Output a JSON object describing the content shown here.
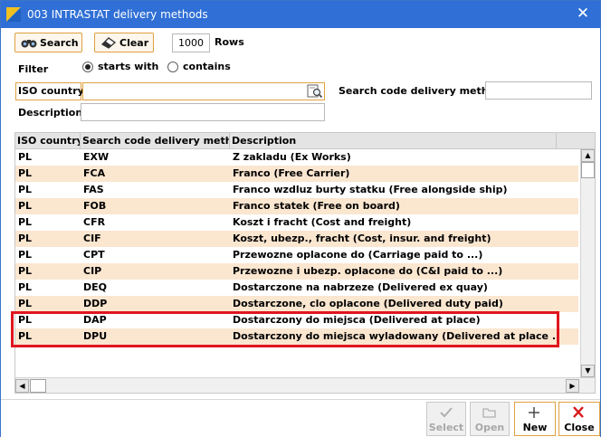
{
  "window": {
    "title": "003 INTRASTAT delivery methods",
    "close_glyph": "✕"
  },
  "toolbar": {
    "search_label": "Search",
    "clear_label": "Clear",
    "rows_value": "1000",
    "rows_label": "Rows"
  },
  "filter": {
    "label": "Filter",
    "options": [
      {
        "label": "starts with",
        "selected": true
      },
      {
        "label": "contains",
        "selected": false
      }
    ],
    "iso_country_label": "ISO country",
    "iso_country_value": "",
    "search_code_label": "Search code delivery method",
    "search_code_value": "",
    "description_label": "Description",
    "description_value": ""
  },
  "grid": {
    "columns": [
      "ISO country",
      "Search code delivery method",
      "Description"
    ],
    "rows": [
      {
        "iso": "PL",
        "code": "EXW",
        "desc": "Z zakladu (Ex Works)"
      },
      {
        "iso": "PL",
        "code": "FCA",
        "desc": "Franco (Free Carrier)"
      },
      {
        "iso": "PL",
        "code": "FAS",
        "desc": "Franco wzdluz burty statku (Free alongside ship)"
      },
      {
        "iso": "PL",
        "code": "FOB",
        "desc": "Franco statek (Free on board)"
      },
      {
        "iso": "PL",
        "code": "CFR",
        "desc": "Koszt i fracht (Cost and freight)"
      },
      {
        "iso": "PL",
        "code": "CIF",
        "desc": "Koszt, ubezp., fracht (Cost, insur. and freight)"
      },
      {
        "iso": "PL",
        "code": "CPT",
        "desc": "Przewozne oplacone do (Carriage paid to ...)"
      },
      {
        "iso": "PL",
        "code": "CIP",
        "desc": "Przewozne i ubezp. oplacone do (C&I paid to ...)"
      },
      {
        "iso": "PL",
        "code": "DEQ",
        "desc": "Dostarczone na nabrzeze (Delivered ex quay)"
      },
      {
        "iso": "PL",
        "code": "DDP",
        "desc": "Dostarczone, clo oplacone (Delivered duty paid)"
      },
      {
        "iso": "PL",
        "code": "DAP",
        "desc": "Dostarczony do miejsca (Delivered at place)"
      },
      {
        "iso": "PL",
        "code": "DPU",
        "desc": "Dostarczony do miejsca wyladowany (Delivered at place ...)"
      }
    ],
    "highlighted_rows": [
      "DAP",
      "DPU"
    ]
  },
  "bottom_buttons": {
    "select_label": "Select",
    "open_label": "Open",
    "new_label": "New",
    "close_label": "Close"
  },
  "colors": {
    "titlebar": "#2f6fd6",
    "row_alt": "#fbe6d0",
    "accent_border": "#e0a040",
    "highlight": "#e0161f"
  },
  "icons": [
    "app-icon",
    "close-icon",
    "binoculars-icon",
    "eraser-icon",
    "lookup-icon",
    "checkmark-icon",
    "folder-icon",
    "plus-icon",
    "red-x-icon"
  ]
}
